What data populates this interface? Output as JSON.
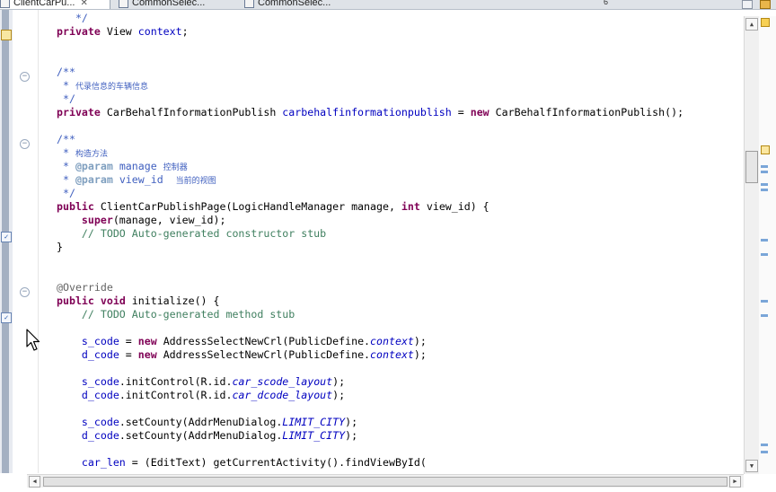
{
  "tabs": [
    {
      "label": "ClientCarPu...",
      "active": true
    },
    {
      "label": "CommonSelec...",
      "active": false
    },
    {
      "label": "CommonSelec...",
      "active": false
    }
  ],
  "tab_overflow_count": "6",
  "code_lines": [
    [
      {
        "t": "   */",
        "c": "cm"
      }
    ],
    [
      {
        "t": "private",
        "c": "kw"
      },
      {
        "t": " View "
      },
      {
        "t": "context",
        "c": "fld"
      },
      {
        "t": ";"
      }
    ],
    [],
    [],
    [
      {
        "t": "/**",
        "c": "cm"
      }
    ],
    [
      {
        "t": " * ",
        "c": "cm"
      },
      {
        "t": "代录信息的车辆信息",
        "c": "cjk"
      }
    ],
    [
      {
        "t": " */",
        "c": "cm"
      }
    ],
    [
      {
        "t": "private",
        "c": "kw"
      },
      {
        "t": " CarBehalfInformationPublish "
      },
      {
        "t": "carbehalfinformationpublish",
        "c": "fld"
      },
      {
        "t": " = "
      },
      {
        "t": "new",
        "c": "kw"
      },
      {
        "t": " CarBehalfInformationPublish();"
      }
    ],
    [],
    [
      {
        "t": "/**",
        "c": "cm"
      }
    ],
    [
      {
        "t": " * ",
        "c": "cm"
      },
      {
        "t": "构造方法",
        "c": "cjk"
      }
    ],
    [
      {
        "t": " * ",
        "c": "cm"
      },
      {
        "t": "@param",
        "c": "tag"
      },
      {
        "t": " manage ",
        "c": "cm"
      },
      {
        "t": "控制器",
        "c": "cjk"
      }
    ],
    [
      {
        "t": " * ",
        "c": "cm"
      },
      {
        "t": "@param",
        "c": "tag"
      },
      {
        "t": " view_id  ",
        "c": "cm"
      },
      {
        "t": "当前的视图",
        "c": "cjk"
      }
    ],
    [
      {
        "t": " */",
        "c": "cm"
      }
    ],
    [
      {
        "t": "public",
        "c": "kw"
      },
      {
        "t": " ClientCarPublishPage(LogicHandleManager manage, "
      },
      {
        "t": "int",
        "c": "kw"
      },
      {
        "t": " view_id) {"
      }
    ],
    [
      {
        "t": "    "
      },
      {
        "t": "super",
        "c": "kw"
      },
      {
        "t": "(manage, view_id);"
      }
    ],
    [
      {
        "t": "    "
      },
      {
        "t": "// TODO Auto-generated constructor stub",
        "c": "lc"
      }
    ],
    [
      {
        "t": "}"
      }
    ],
    [],
    [],
    [
      {
        "t": "@Override",
        "c": "ann"
      }
    ],
    [
      {
        "t": "public",
        "c": "kw"
      },
      {
        "t": " "
      },
      {
        "t": "void",
        "c": "kw"
      },
      {
        "t": " initialize() {"
      }
    ],
    [
      {
        "t": "    "
      },
      {
        "t": "// TODO Auto-generated method stub",
        "c": "lc"
      }
    ],
    [],
    [
      {
        "t": "    "
      },
      {
        "t": "s_code",
        "c": "fld"
      },
      {
        "t": " = "
      },
      {
        "t": "new",
        "c": "kw"
      },
      {
        "t": " AddressSelectNewCrl(PublicDefine."
      },
      {
        "t": "context",
        "c": "sfld"
      },
      {
        "t": ");"
      }
    ],
    [
      {
        "t": "    "
      },
      {
        "t": "d_code",
        "c": "fld"
      },
      {
        "t": " = "
      },
      {
        "t": "new",
        "c": "kw"
      },
      {
        "t": " AddressSelectNewCrl(PublicDefine."
      },
      {
        "t": "context",
        "c": "sfld"
      },
      {
        "t": ");"
      }
    ],
    [],
    [
      {
        "t": "    "
      },
      {
        "t": "s_code",
        "c": "fld"
      },
      {
        "t": ".initControl(R.id."
      },
      {
        "t": "car_scode_layout",
        "c": "sfld"
      },
      {
        "t": ");"
      }
    ],
    [
      {
        "t": "    "
      },
      {
        "t": "d_code",
        "c": "fld"
      },
      {
        "t": ".initControl(R.id."
      },
      {
        "t": "car_dcode_layout",
        "c": "sfld"
      },
      {
        "t": ");"
      }
    ],
    [],
    [
      {
        "t": "    "
      },
      {
        "t": "s_code",
        "c": "fld"
      },
      {
        "t": ".setCounty(AddrMenuDialog."
      },
      {
        "t": "LIMIT_CITY",
        "c": "sfld"
      },
      {
        "t": ");"
      }
    ],
    [
      {
        "t": "    "
      },
      {
        "t": "d_code",
        "c": "fld"
      },
      {
        "t": ".setCounty(AddrMenuDialog."
      },
      {
        "t": "LIMIT_CITY",
        "c": "sfld"
      },
      {
        "t": ");"
      }
    ],
    [],
    [
      {
        "t": "    "
      },
      {
        "t": "car_len",
        "c": "fld"
      },
      {
        "t": " = (EditText) getCurrentActivity().findViewById("
      }
    ]
  ],
  "scroll_arrows": {
    "up": "▲",
    "down": "▼",
    "left": "◀",
    "right": "▶"
  },
  "fold_glyph": "−",
  "colors": {
    "keyword": "#7f0055",
    "comment": "#3f5fbf",
    "line_comment": "#3f7f5f",
    "field": "#0000c0",
    "annotation": "#646464"
  }
}
